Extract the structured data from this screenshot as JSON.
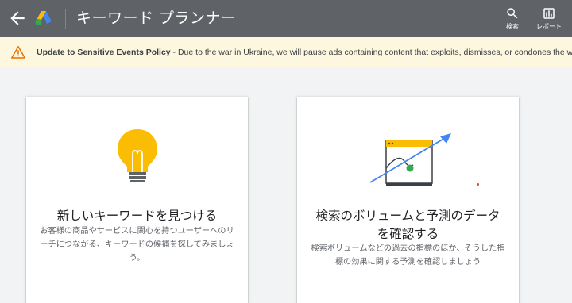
{
  "header": {
    "title": "キーワード プランナー",
    "tools": [
      {
        "label": "検索",
        "icon": "search-icon"
      },
      {
        "label": "レポート",
        "icon": "bar-chart-icon"
      }
    ]
  },
  "banner": {
    "bold_text": "Update to Sensitive Events Policy",
    "text": " - Due to the war in Ukraine, we will pause ads containing content that exploits, dismisses, or condones the war."
  },
  "cards": [
    {
      "title": "新しいキーワードを見つける",
      "description": "お客様の商品やサービスに関心を持つユーザーへのリーチにつながる、キーワードの候補を探してみましょう。",
      "icon": "lightbulb-icon"
    },
    {
      "title": "検索のボリュームと予測のデータを確認する",
      "description": "検索ボリュームなどの過去の指標のほか、そうした指標の効果に関する予測を確認しましょう",
      "icon": "trend-chart-icon"
    }
  ],
  "colors": {
    "header_bg": "#5f6368",
    "banner_bg": "#fef7e0",
    "warning": "#e37400",
    "yellow": "#fbbc04",
    "blue": "#4285f4",
    "green": "#34a853"
  }
}
